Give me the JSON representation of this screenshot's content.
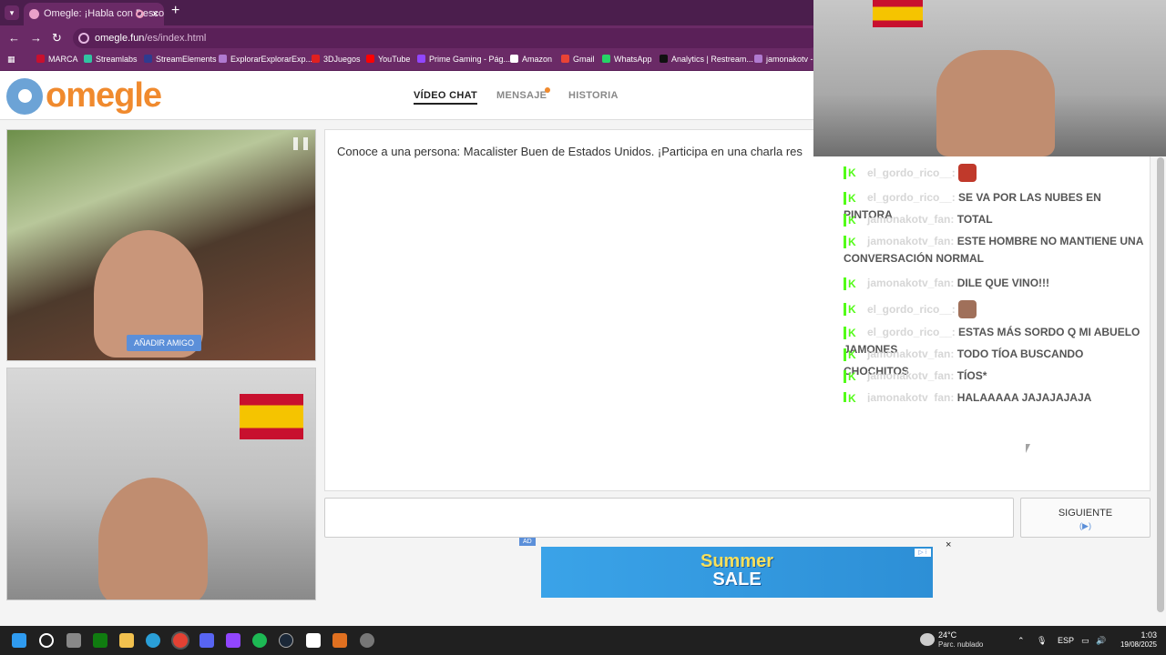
{
  "browser": {
    "tab_title": "Omegle: ¡Habla con Descon",
    "tab_close": "×",
    "new_tab": "+",
    "url_host": "omegle.fun",
    "url_path": "/es/index.html",
    "nav_back": "←",
    "nav_forward": "→",
    "nav_reload": "↻",
    "bookmarks": [
      "MARCA",
      "Streamlabs",
      "StreamElements",
      "ExplorarExplorarExp...",
      "3DJuegos",
      "YouTube",
      "Prime Gaming - Pág...",
      "Amazon",
      "Gmail",
      "WhatsApp",
      "Analytics | Restream...",
      "jamonakotv - T"
    ]
  },
  "site": {
    "logo": "omegle",
    "nav": {
      "video_chat": "VÍDEO CHAT",
      "message": "MENSAJE",
      "history": "HISTORIA"
    },
    "add_friend": "AÑADIR AMIGO",
    "chat_message": "Conoce a una persona: Macalister Buen de Estados Unidos. ¡Participa en una charla res",
    "next_label": "SIGUIENTE",
    "next_sub": "(▶)",
    "ad_tag": "AD",
    "ad_line1": "Summer",
    "ad_line2": "SALE",
    "ad_close": "×",
    "ad_info": "▷ ⁝"
  },
  "stream_chat": [
    {
      "user": "el_gordo_rico__:",
      "text": "",
      "emote": "#c0392b"
    },
    {
      "user": "el_gordo_rico__:",
      "text": "SE VA POR LAS NUBES EN PINTORA",
      "emote": ""
    },
    {
      "user": "jamonakotv_fan:",
      "text": "TOTAL",
      "emote": ""
    },
    {
      "user": "jamonakotv_fan:",
      "text": "ESTE HOMBRE NO MANTIENE UNA CONVERSACIÓN NORMAL",
      "emote": ""
    },
    {
      "user": "jamonakotv_fan:",
      "text": "DILE QUE VINO!!!",
      "emote": ""
    },
    {
      "user": "el_gordo_rico__:",
      "text": "",
      "emote": "#a0705a"
    },
    {
      "user": "el_gordo_rico__:",
      "text": "ESTAS MÁS SORDO Q MI ABUELO JAMONES",
      "emote": ""
    },
    {
      "user": "jamonakotv_fan:",
      "text": "TODO TÍOA BUSCANDO CHOCHITOS",
      "emote": ""
    },
    {
      "user": "jamonakotv_fan:",
      "text": "TÍOS*",
      "emote": ""
    },
    {
      "user": "jamonakotv_fan:",
      "text": "HALAAAAA JAJAJAJAJA",
      "emote": ""
    }
  ],
  "taskbar": {
    "weather_temp": "24°C",
    "weather_desc": "Parc. nublado",
    "lang": "ESP",
    "time": "1:03",
    "date": "19/08/2025"
  },
  "colors": {
    "accent": "#f08a2e",
    "brand_blue": "#5b8fd9",
    "kick_green": "#53fc18",
    "browser_purple": "#6a2a66"
  }
}
